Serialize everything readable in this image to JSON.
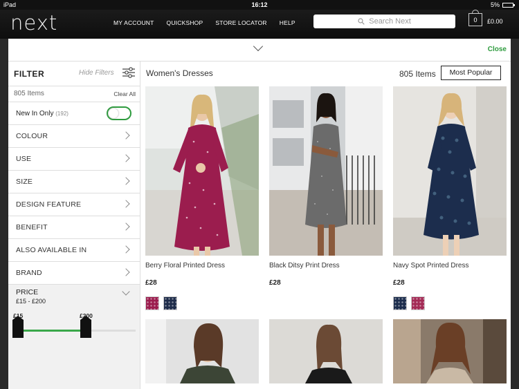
{
  "status": {
    "device": "iPad",
    "time": "16:12",
    "battery": "5%"
  },
  "header": {
    "logo": "next",
    "nav": [
      "MY ACCOUNT",
      "QUICKSHOP",
      "STORE LOCATOR",
      "HELP"
    ],
    "search_placeholder": "Search Next",
    "bag_count": "0",
    "bag_total": "£0.00"
  },
  "panel": {
    "close_label": "Close"
  },
  "sidebar": {
    "title": "FILTER",
    "hide_label": "Hide Filters",
    "count": "805 Items",
    "clear_label": "Clear All",
    "new_in_label": "New In Only",
    "new_in_count": "(192)",
    "categories": [
      "COLOUR",
      "USE",
      "SIZE",
      "DESIGN FEATURE",
      "BENEFIT",
      "ALSO AVAILABLE IN",
      "BRAND"
    ],
    "price_title": "PRICE",
    "price_range": "£15 - £200",
    "price_min": "£15",
    "price_max": "£200",
    "price_fill_fraction": 0.58
  },
  "main": {
    "title": "Women's Dresses",
    "count": "805 Items",
    "sort_label": "Most Popular"
  },
  "products": [
    {
      "name": "Berry Floral Printed Dress",
      "price": "£28",
      "dress_color": "#9b1d4e",
      "swatches": [
        "#9b1d4e",
        "#1e2c4a"
      ]
    },
    {
      "name": "Black Ditsy Print Dress",
      "price": "£28",
      "dress_color": "#555555",
      "swatches": []
    },
    {
      "name": "Navy Spot Printed Dress",
      "price": "£28",
      "dress_color": "#1c2d4d",
      "swatches": [
        "#1c2d4d",
        "#a32a55"
      ]
    }
  ],
  "colors": {
    "accent_green": "#2e9b3e"
  }
}
